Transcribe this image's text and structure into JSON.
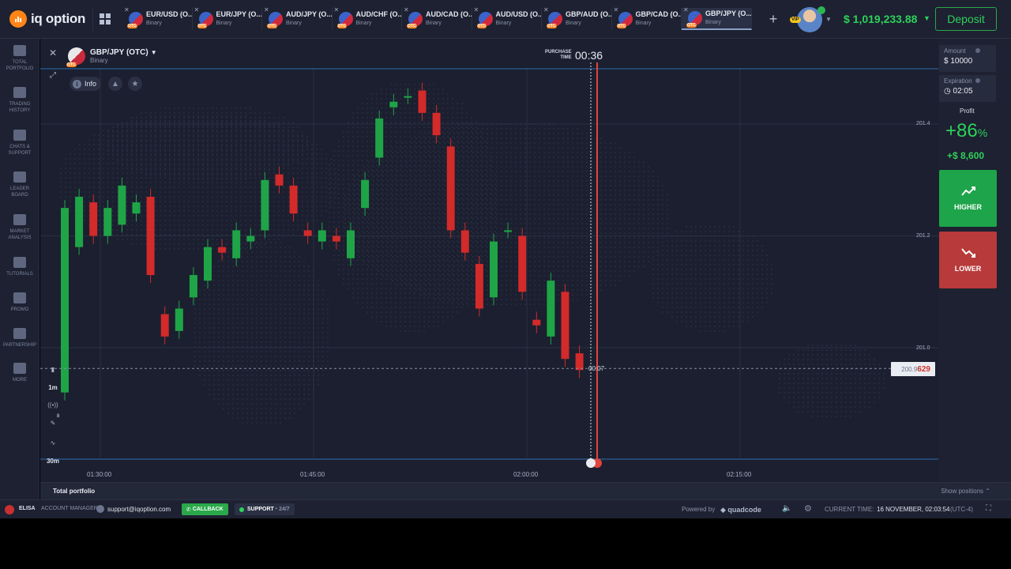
{
  "app": {
    "logo_text": "iq option"
  },
  "tabs": [
    {
      "name": "EUR/USD (O...",
      "sub": "Binary"
    },
    {
      "name": "EUR/JPY (O...",
      "sub": "Binary"
    },
    {
      "name": "AUD/JPY (O...",
      "sub": "Binary"
    },
    {
      "name": "AUD/CHF (O...",
      "sub": "Binary"
    },
    {
      "name": "AUD/CAD (O...",
      "sub": "Binary"
    },
    {
      "name": "AUD/USD (O...",
      "sub": "Binary"
    },
    {
      "name": "GBP/AUD (O...",
      "sub": "Binary"
    },
    {
      "name": "GBP/CAD (O...",
      "sub": "Binary"
    },
    {
      "name": "GBP/JPY (O...",
      "sub": "Binary"
    }
  ],
  "active_tab_index": 8,
  "header": {
    "vip": "VIP",
    "balance": "$ 1,019,233.88",
    "deposit_label": "Deposit"
  },
  "sidebar": [
    {
      "label": "TOTAL\nPORTFOLIO",
      "icon": "briefcase-icon"
    },
    {
      "label": "TRADING\nHISTORY",
      "icon": "clock-icon"
    },
    {
      "label": "CHATS &\nSUPPORT",
      "icon": "chat-icon"
    },
    {
      "label": "LEADER\nBOARD",
      "icon": "leaderboard-icon"
    },
    {
      "label": "MARKET\nANALYSIS",
      "icon": "analysis-icon"
    },
    {
      "label": "TUTORIALS",
      "icon": "tutorials-icon"
    },
    {
      "label": "PROMO",
      "icon": "promo-icon"
    },
    {
      "label": "PARTNERSHIP",
      "icon": "partnership-icon"
    },
    {
      "label": "MORE",
      "icon": "more-icon"
    }
  ],
  "asset": {
    "name": "GBP/JPY (OTC)",
    "type": "Binary",
    "otc_badge": "OTC"
  },
  "chart_toolbar": {
    "info_label": "Info"
  },
  "chart_tools": {
    "timeframe": "1m",
    "period": "30m",
    "badge": "8"
  },
  "purchase": {
    "label_line1": "PURCHASE",
    "label_line2": "TIME",
    "time": "00:36"
  },
  "countdown": "00:07",
  "current_price": {
    "prefix": "200.9",
    "suffix": "629"
  },
  "price_axis": [
    "201.4",
    "201.2",
    "201.0"
  ],
  "time_axis": [
    "01:30:00",
    "01:45:00",
    "02:00:00",
    "02:15:00"
  ],
  "candles": [
    [
      200.92,
      201.25
    ],
    [
      201.18,
      201.27
    ],
    [
      201.26,
      201.2
    ],
    [
      201.2,
      201.25
    ],
    [
      201.22,
      201.29
    ],
    [
      201.24,
      201.26
    ],
    [
      201.27,
      201.13
    ],
    [
      201.06,
      201.02
    ],
    [
      201.03,
      201.07
    ],
    [
      201.09,
      201.13
    ],
    [
      201.12,
      201.18
    ],
    [
      201.18,
      201.17
    ],
    [
      201.16,
      201.21
    ],
    [
      201.19,
      201.2
    ],
    [
      201.21,
      201.3
    ],
    [
      201.31,
      201.29
    ],
    [
      201.29,
      201.24
    ],
    [
      201.21,
      201.2
    ],
    [
      201.19,
      201.21
    ],
    [
      201.2,
      201.19
    ],
    [
      201.16,
      201.21
    ],
    [
      201.25,
      201.3
    ],
    [
      201.34,
      201.41
    ],
    [
      201.43,
      201.44
    ],
    [
      201.45,
      201.45
    ],
    [
      201.46,
      201.42
    ],
    [
      201.42,
      201.38
    ],
    [
      201.36,
      201.21
    ],
    [
      201.21,
      201.17
    ],
    [
      201.15,
      201.07
    ],
    [
      201.09,
      201.19
    ],
    [
      201.21,
      201.21
    ],
    [
      201.2,
      201.1
    ],
    [
      201.05,
      201.04
    ],
    [
      201.02,
      201.12
    ],
    [
      201.1,
      200.98
    ],
    [
      200.99,
      200.96
    ]
  ],
  "trade": {
    "amount_label": "Amount",
    "amount_value": "$ 10000",
    "expiration_label": "Expiration",
    "expiration_value": "02:05",
    "profit_label": "Profit",
    "profit_pct": "+86",
    "profit_pct_sign": "%",
    "profit_amount": "+$ 8,600",
    "higher_label": "HIGHER",
    "lower_label": "LOWER"
  },
  "portfolio": {
    "title": "Total portfolio",
    "show_positions": "Show positions"
  },
  "status": {
    "user": "ELISA",
    "account_manager": "ACCOUNT MANAGER",
    "email": "support@iqoption.com",
    "callback": "CALLBACK",
    "support": "SUPPORT",
    "support_hours": "24/7",
    "powered_by": "Powered by",
    "brand": "quadcode",
    "current_time_label": "CURRENT TIME:",
    "current_time": "16 NOVEMBER, 02:03:54",
    "timezone": "(UTC-4)"
  },
  "colors": {
    "up": "#1fa547",
    "down": "#d32a2a",
    "accent": "#2ed15a",
    "bg": "#1b1f2f"
  }
}
